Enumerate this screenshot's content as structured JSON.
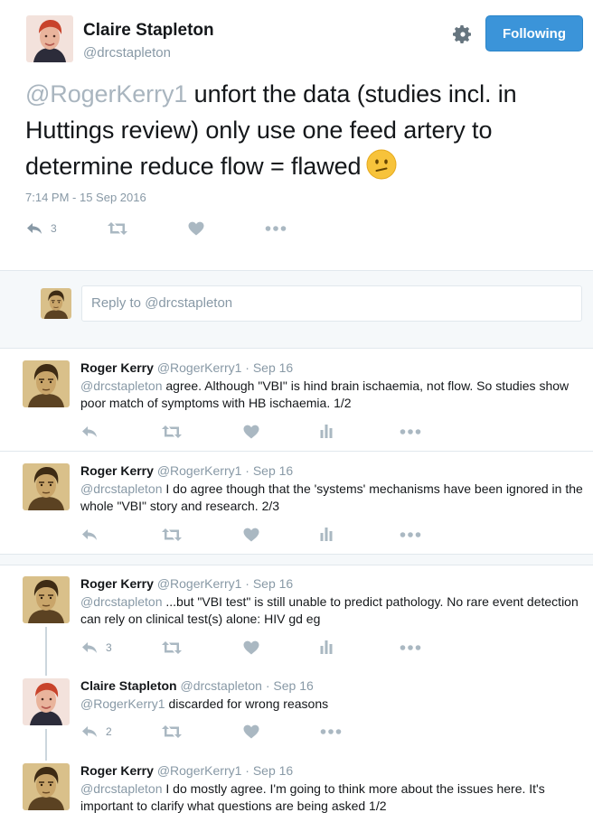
{
  "main_tweet": {
    "name": "Claire Stapleton",
    "handle": "@drcstapleton",
    "follow_label": "Following",
    "mention": "@RogerKerry1",
    "text": " unfort the data (studies incl. in Huttings review) only use one feed artery to determine reduce flow = flawed",
    "timestamp": "7:14 PM - 15 Sep 2016",
    "reply_count": "3",
    "emoji_icon": "confused-face-icon"
  },
  "reply_box": {
    "placeholder": "Reply to @drcstapleton"
  },
  "replies": [
    {
      "name": "Roger Kerry",
      "handle": "@RogerKerry1",
      "date": "· Sep 16",
      "mention": "@drcstapleton",
      "text": " agree. Although \"VBI\" is hind brain ischaemia, not flow. So studies show poor match of symptoms with HB ischaemia. 1/2",
      "reply_count": ""
    },
    {
      "name": "Roger Kerry",
      "handle": "@RogerKerry1",
      "date": "· Sep 16",
      "mention": "@drcstapleton",
      "text": " I do agree though that the 'systems' mechanisms have been ignored in the whole \"VBI\" story and research. 2/3",
      "reply_count": ""
    },
    {
      "name": "Roger Kerry",
      "handle": "@RogerKerry1",
      "date": "· Sep 16",
      "mention": "@drcstapleton",
      "text": " ...but \"VBI test\" is still unable to predict pathology. No rare event detection can rely on clinical test(s) alone: HIV gd eg",
      "reply_count": "3"
    },
    {
      "name": "Claire Stapleton",
      "handle": "@drcstapleton",
      "date": "· Sep 16",
      "mention": "@RogerKerry1",
      "text": " discarded for wrong reasons",
      "reply_count": "2"
    },
    {
      "name": "Roger Kerry",
      "handle": "@RogerKerry1",
      "date": "· Sep 16",
      "mention": "@drcstapleton",
      "text": " I do mostly agree. I'm going to think more about the issues here. It's important to clarify what questions are being asked 1/2",
      "reply_count": ""
    }
  ],
  "icons": {
    "reply": "reply-icon",
    "retweet": "retweet-icon",
    "like": "heart-icon",
    "analytics": "analytics-icon",
    "more": "more-icon",
    "settings": "gear-icon"
  },
  "colors": {
    "follow_button": "#3b94d9",
    "mention": "#8899a6",
    "icon": "#aab8c2",
    "background_gap": "#f5f8fa"
  }
}
